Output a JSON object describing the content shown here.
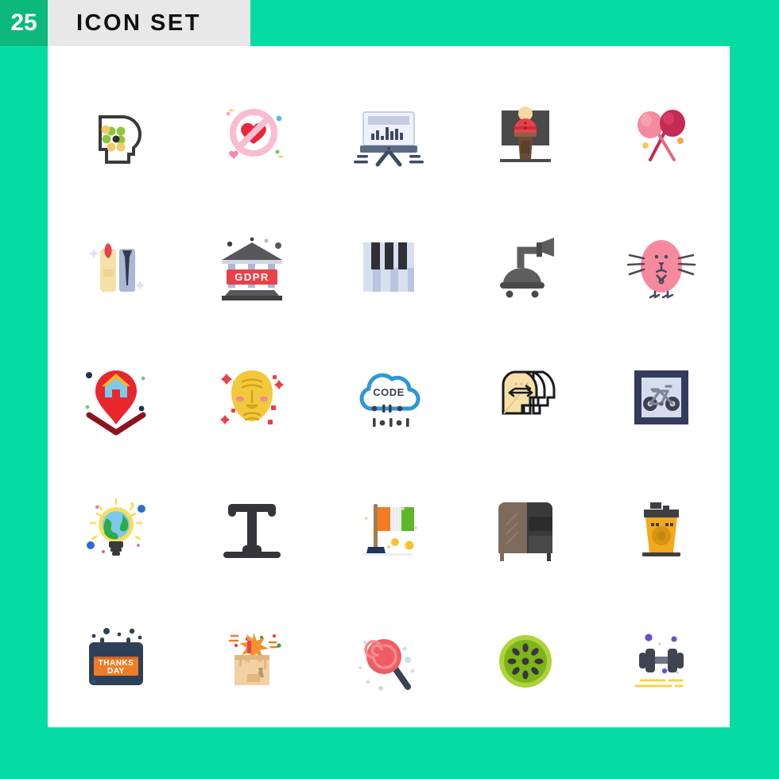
{
  "header": {
    "count": "25",
    "title": "ICON SET",
    "badge_color": "#0ab97b",
    "title_bg": "#e8e8e8",
    "page_bg": "#04dca4",
    "card_bg": "#ffffff"
  },
  "grid": {
    "columns": 5,
    "rows": 5,
    "total_icons": 25
  },
  "icons": [
    {
      "index": 1,
      "name": "mind-head-icon",
      "label": "Head with colored dots",
      "row": 1,
      "col": 1,
      "colors": [
        "#3a3a3a",
        "#8cc63f",
        "#f3c969",
        "#ef6f6c",
        "#333333"
      ]
    },
    {
      "index": 2,
      "name": "no-love-icon",
      "label": "Prohibited heart",
      "row": 1,
      "col": 2,
      "colors": [
        "#f9bcd0",
        "#e8273a",
        "#7fc8e8",
        "#f6d365"
      ]
    },
    {
      "index": 3,
      "name": "presentation-chart-icon",
      "label": "Presentation board with chart",
      "row": 1,
      "col": 3,
      "colors": [
        "#dfe5f0",
        "#5c6a85",
        "#2f3a4d"
      ]
    },
    {
      "index": 4,
      "name": "podium-speaker-icon",
      "label": "Speaker at podium",
      "row": 1,
      "col": 4,
      "colors": [
        "#4a4a4a",
        "#f6d9a0",
        "#e8414a",
        "#6d4c36"
      ]
    },
    {
      "index": 5,
      "name": "lollipops-icon",
      "label": "Two crossed lollipops",
      "row": 1,
      "col": 5,
      "colors": [
        "#f48a9e",
        "#c42a53",
        "#f4c85f"
      ]
    },
    {
      "index": 6,
      "name": "nail-polish-icon",
      "label": "Nail polish and file",
      "row": 2,
      "col": 1,
      "colors": [
        "#f7dfa8",
        "#e8414a",
        "#aab8d6",
        "#2f3a4d"
      ]
    },
    {
      "index": 7,
      "name": "gdpr-building-icon",
      "label": "GDPR government building",
      "row": 2,
      "col": 2,
      "text": "GDPR",
      "colors": [
        "#58585c",
        "#e8414a",
        "#aab8d6",
        "#3f3f43"
      ]
    },
    {
      "index": 8,
      "name": "piano-keys-icon",
      "label": "Piano keys",
      "row": 2,
      "col": 3,
      "colors": [
        "#d7e0f0",
        "#b9c6de",
        "#2f3036"
      ]
    },
    {
      "index": 9,
      "name": "shower-head-icon",
      "label": "Shower head",
      "row": 2,
      "col": 4,
      "colors": [
        "#5e5e5e",
        "#4a4a4a"
      ]
    },
    {
      "index": 10,
      "name": "easter-egg-bunny-icon",
      "label": "Pink easter egg bunny",
      "row": 2,
      "col": 5,
      "colors": [
        "#f7899f",
        "#4a4a5a"
      ]
    },
    {
      "index": 11,
      "name": "home-location-pin-icon",
      "label": "Location pin with house",
      "row": 3,
      "col": 1,
      "colors": [
        "#e8262e",
        "#8f1220",
        "#7ec9ea",
        "#f4b72a"
      ]
    },
    {
      "index": 12,
      "name": "face-mask-icon",
      "label": "Yellow face with wrinkles",
      "row": 3,
      "col": 2,
      "colors": [
        "#f2c93c",
        "#e8414a",
        "#f08a9a"
      ]
    },
    {
      "index": 13,
      "name": "cloud-code-icon",
      "label": "Cloud with code",
      "row": 3,
      "col": 3,
      "text": "CODE",
      "colors": [
        "#2f97d4",
        "#3a3f4a"
      ]
    },
    {
      "index": 14,
      "name": "empathy-heads-icon",
      "label": "Heads with two-way arrow",
      "row": 3,
      "col": 4,
      "colors": [
        "#f7e0a8",
        "#1a1a1a"
      ]
    },
    {
      "index": 15,
      "name": "bicycle-sign-icon",
      "label": "Framed bicycle sign",
      "row": 3,
      "col": 5,
      "colors": [
        "#343b5c",
        "#d5dced",
        "#5a5f6a"
      ]
    },
    {
      "index": 16,
      "name": "eco-bulb-icon",
      "label": "Light bulb with globe",
      "row": 4,
      "col": 1,
      "colors": [
        "#f6dd60",
        "#2bab4a",
        "#7ec9ea",
        "#2f6bd4",
        "#3a3a3a"
      ]
    },
    {
      "index": 17,
      "name": "text-tool-icon",
      "label": "Text tool letter T",
      "row": 4,
      "col": 2,
      "colors": [
        "#34343a"
      ]
    },
    {
      "index": 18,
      "name": "ireland-flag-icon",
      "label": "Ireland flag on stand",
      "row": 4,
      "col": 3,
      "colors": [
        "#f57b20",
        "#ffffff",
        "#5cb829",
        "#a67c52",
        "#24355c",
        "#f4c430"
      ]
    },
    {
      "index": 19,
      "name": "dresser-cabinet-icon",
      "label": "Dresser cabinet",
      "row": 4,
      "col": 4,
      "colors": [
        "#7d6a5b",
        "#3a3a3c",
        "#2c2c2e"
      ]
    },
    {
      "index": 20,
      "name": "coffee-machine-icon",
      "label": "Yellow coffee machine",
      "row": 4,
      "col": 5,
      "colors": [
        "#f0aa1e",
        "#3f3f43"
      ]
    },
    {
      "index": 21,
      "name": "thanks-day-calendar-icon",
      "label": "Thanks Day calendar",
      "row": 5,
      "col": 1,
      "text": "THANKS DAY",
      "colors": [
        "#2e4057",
        "#f07c28",
        "#ffffff"
      ]
    },
    {
      "index": 22,
      "name": "surprise-box-icon",
      "label": "Open box with firework",
      "row": 5,
      "col": 2,
      "colors": [
        "#f2d0a4",
        "#e09f5c",
        "#f2932f",
        "#e8414a",
        "#2bab4a"
      ]
    },
    {
      "index": 23,
      "name": "swirl-lollipop-icon",
      "label": "Swirl lollipop",
      "row": 5,
      "col": 3,
      "colors": [
        "#ef5d62",
        "#f08a8e",
        "#3a4250"
      ]
    },
    {
      "index": 24,
      "name": "kiwi-slice-icon",
      "label": "Kiwi fruit slice",
      "row": 5,
      "col": 4,
      "colors": [
        "#aed23b",
        "#7cb518",
        "#3a3346"
      ]
    },
    {
      "index": 25,
      "name": "dumbbell-icon",
      "label": "Dumbbell with motion lines",
      "row": 5,
      "col": 5,
      "colors": [
        "#3f4450",
        "#6e7585",
        "#6b4fc8",
        "#f5d547"
      ]
    }
  ]
}
